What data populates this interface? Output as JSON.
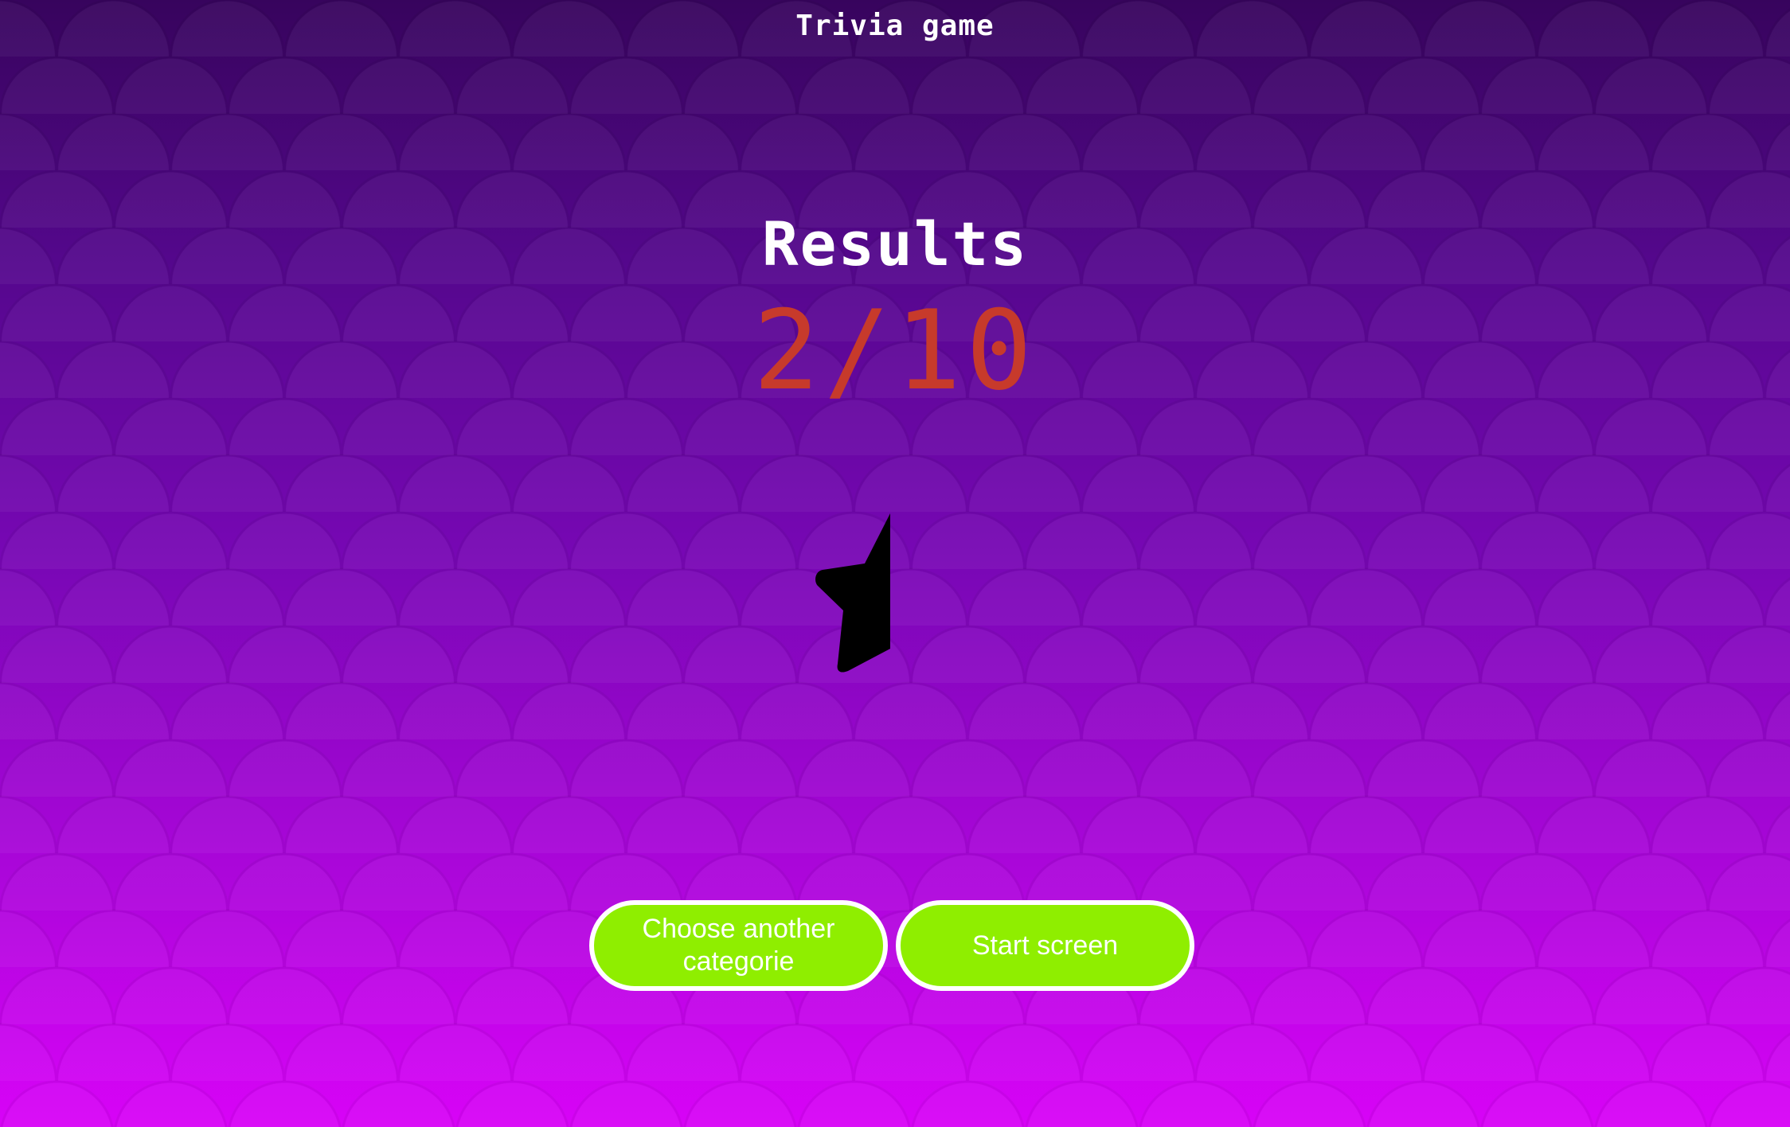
{
  "app": {
    "title": "Trivia game"
  },
  "results": {
    "heading": "Results",
    "score": "2/10",
    "score_color": "#c73a2b",
    "rating_icon": "half-star-icon",
    "rating_fill": 0.5
  },
  "actions": {
    "choose_category_label": "Choose another categorie",
    "start_screen_label": "Start screen",
    "button_color": "#8fee00"
  },
  "theme": {
    "background_top": "#37045d",
    "background_bottom": "#d803f7"
  }
}
